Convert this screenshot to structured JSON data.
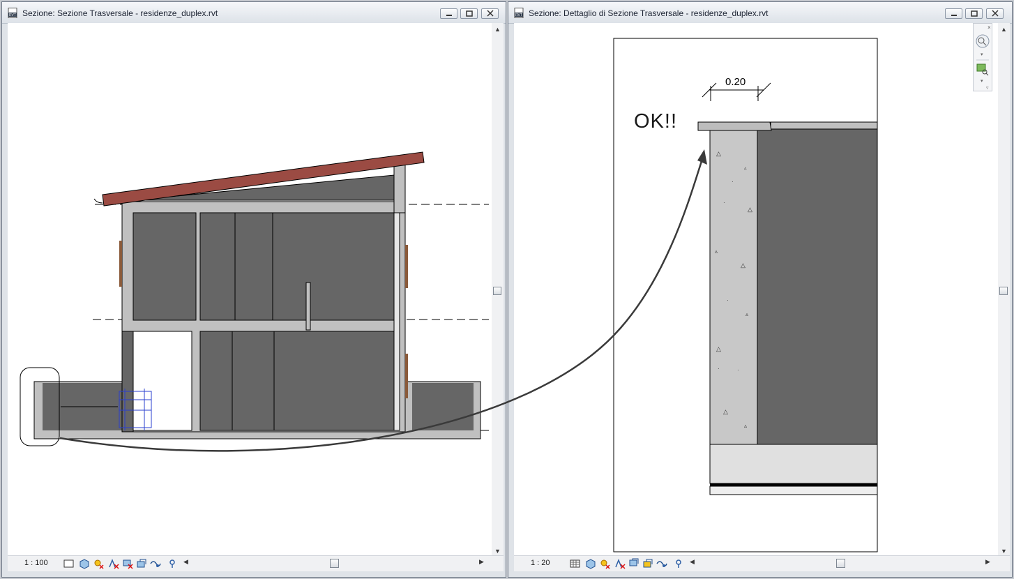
{
  "left_window": {
    "title": "Sezione: Sezione Trasversale - residenze_duplex.rvt",
    "scale": "1 : 100"
  },
  "right_window": {
    "title": "Sezione: Dettaglio di Sezione Trasversale - residenze_duplex.rvt",
    "scale": "1 : 20",
    "dimension_label": "0.20",
    "annotation_text": "OK!!"
  },
  "icons": [
    "revit-file-icon",
    "minimize-icon",
    "maximize-icon",
    "close-icon",
    "crop-region-icon",
    "3d-box-icon",
    "sun-path-icon",
    "hide-element-icon",
    "temporary-hide-icon",
    "reveal-hidden-icon",
    "analysis-icon",
    "pin-icon",
    "zoom-icon",
    "navigation-wheel-icon"
  ],
  "colors": {
    "roof": "#9b4b43",
    "wall_fill": "#666666",
    "structure": "#c0c0c0",
    "selection_blue": "#2a3fcf",
    "arrow": "#3a3a3a"
  }
}
